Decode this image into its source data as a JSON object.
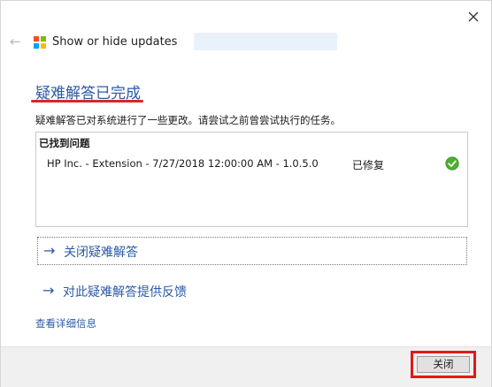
{
  "header": {
    "app_title": "Show or hide updates",
    "logo_colors": [
      "#f25022",
      "#7fba00",
      "#00a4ef",
      "#ffb900"
    ]
  },
  "main": {
    "heading": "疑难解答已完成",
    "description": "疑难解答已对系统进行了一些更改。请尝试之前曾尝试执行的任务。",
    "problems_header": "已找到问题",
    "problems": [
      {
        "name": "HP Inc. - Extension - 7/27/2018 12:00:00 AM - 1.0.5.0",
        "status": "已修复"
      }
    ],
    "actions": {
      "close_troubleshooter": "关闭疑难解答",
      "feedback": "对此疑难解答提供反馈"
    },
    "details_link": "查看详细信息"
  },
  "footer": {
    "close_label": "关闭"
  },
  "colors": {
    "accent": "#2a5aa8",
    "highlight_red": "#e11919",
    "status_green": "#4caf2f"
  }
}
